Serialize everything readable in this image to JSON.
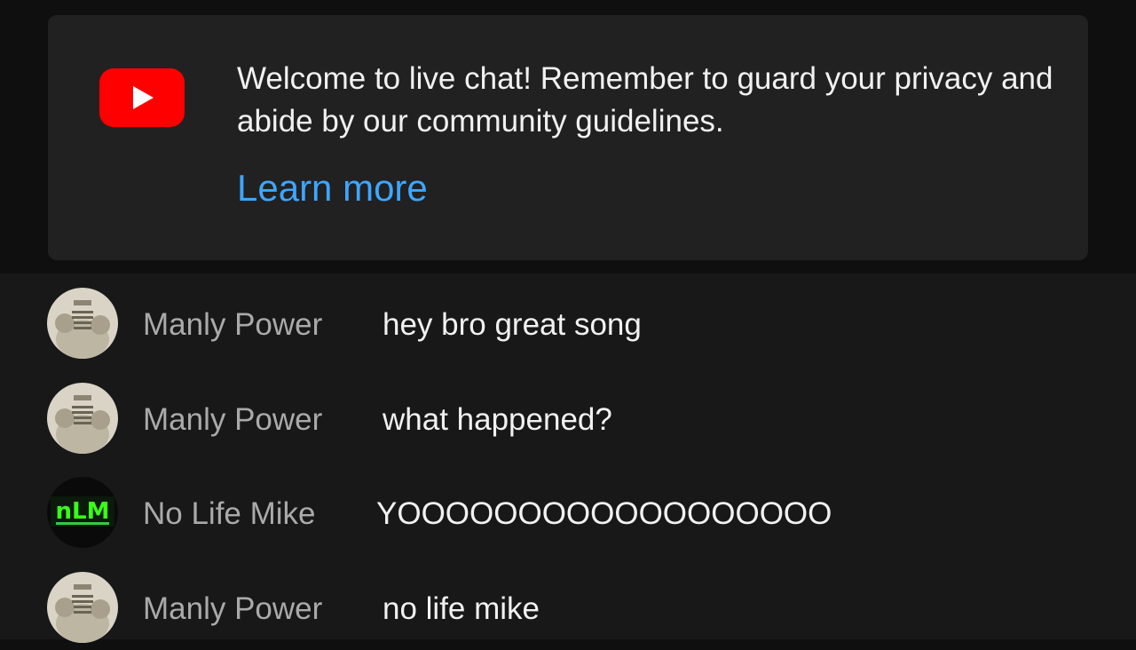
{
  "welcome": {
    "message": "Welcome to live chat! Remember to guard your privacy and abide by our community guidelines.",
    "learn_more": "Learn more",
    "logo_icon": "youtube-logo-icon",
    "logo_color": "#ff0000",
    "link_color": "#3ea6ff"
  },
  "messages": [
    {
      "author": "Manly Power",
      "text": "hey bro great song",
      "avatar": "manly-power-avatar"
    },
    {
      "author": "Manly Power",
      "text": "what happened?",
      "avatar": "manly-power-avatar"
    },
    {
      "author": "No Life Mike",
      "text": "YOOOOOOOOOOOOOOOOOO",
      "avatar": "no-life-mike-avatar",
      "avatar_text": "nLM",
      "avatar_color": "#39ff14"
    },
    {
      "author": "Manly Power",
      "text": "no life mike",
      "avatar": "manly-power-avatar"
    }
  ]
}
